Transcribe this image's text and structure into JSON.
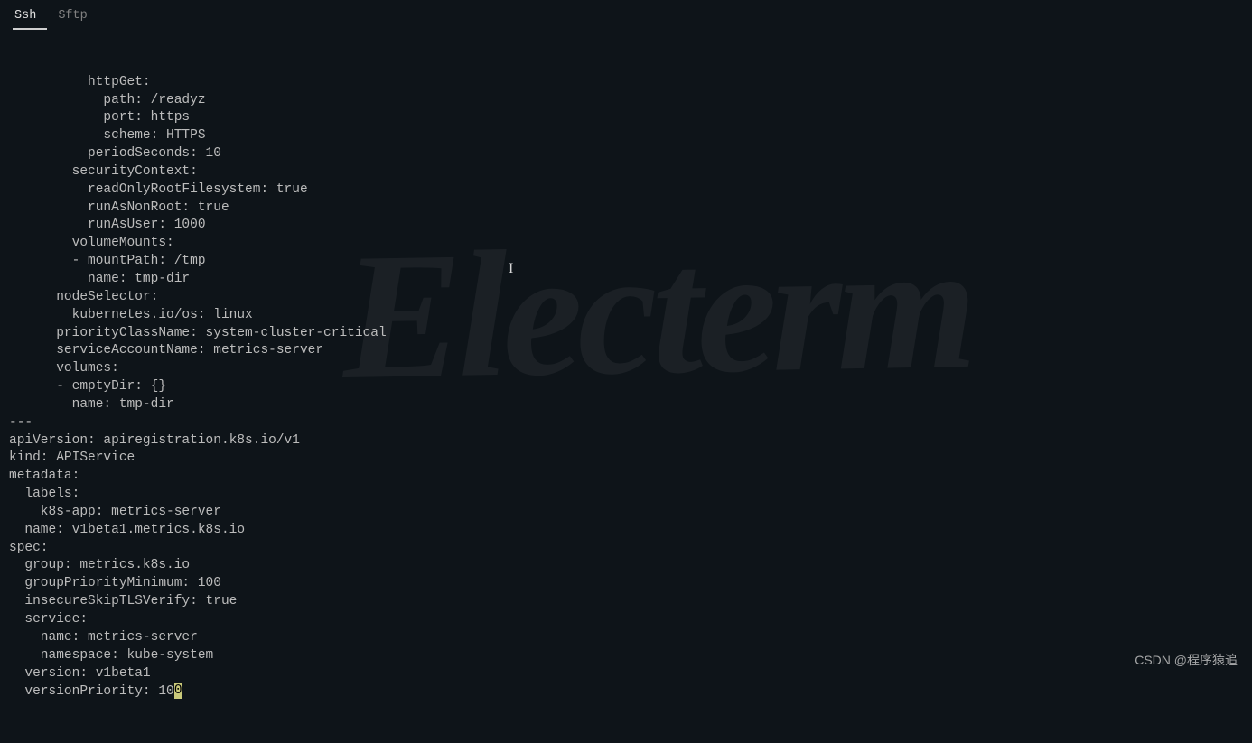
{
  "tabs": {
    "ssh": "Ssh",
    "sftp": "Sftp"
  },
  "terminal": {
    "lines": [
      "          httpGet:",
      "            path: /readyz",
      "            port: https",
      "            scheme: HTTPS",
      "          periodSeconds: 10",
      "        securityContext:",
      "          readOnlyRootFilesystem: true",
      "          runAsNonRoot: true",
      "          runAsUser: 1000",
      "        volumeMounts:",
      "        - mountPath: /tmp",
      "          name: tmp-dir",
      "      nodeSelector:",
      "        kubernetes.io/os: linux",
      "      priorityClassName: system-cluster-critical",
      "      serviceAccountName: metrics-server",
      "      volumes:",
      "      - emptyDir: {}",
      "        name: tmp-dir",
      "---",
      "apiVersion: apiregistration.k8s.io/v1",
      "kind: APIService",
      "metadata:",
      "  labels:",
      "    k8s-app: metrics-server",
      "  name: v1beta1.metrics.k8s.io",
      "spec:",
      "  group: metrics.k8s.io",
      "  groupPriorityMinimum: 100",
      "  insecureSkipTLSVerify: true",
      "  service:",
      "    name: metrics-server",
      "    namespace: kube-system",
      "  version: v1beta1",
      "  versionPriority: 10"
    ],
    "cursor_char": "0"
  },
  "watermark_logo": "Electerm",
  "watermark": "CSDN @程序猿追"
}
